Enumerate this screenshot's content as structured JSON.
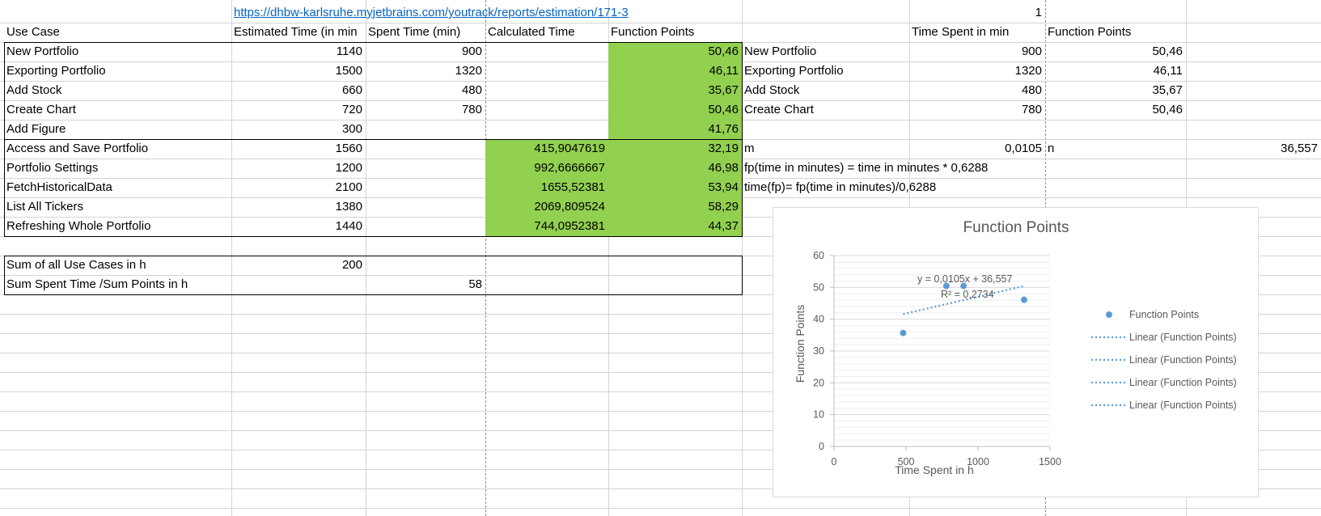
{
  "sheet": {
    "link": "https://dhbw-karlsruhe.myjetbrains.com/youtrack/reports/estimation/171-3",
    "top_value": "1",
    "headers": {
      "use_case": "Use Case",
      "estimated_time": "Estimated Time (in min",
      "spent_time": "Spent Time (min)",
      "calculated_time": "Calculated Time",
      "function_points": "Function Points",
      "right_time": "Time Spent in min",
      "right_fp": "Function Points"
    },
    "rows": [
      {
        "use_case": "New Portfolio",
        "estimated": "1140",
        "spent": "900",
        "calculated": "",
        "fp": "50,46"
      },
      {
        "use_case": "Exporting Portfolio",
        "estimated": "1500",
        "spent": "1320",
        "calculated": "",
        "fp": "46,11"
      },
      {
        "use_case": "Add Stock",
        "estimated": "660",
        "spent": "480",
        "calculated": "",
        "fp": "35,67"
      },
      {
        "use_case": "Create Chart",
        "estimated": "720",
        "spent": "780",
        "calculated": "",
        "fp": "50,46"
      },
      {
        "use_case": "Add Figure",
        "estimated": "300",
        "spent": "",
        "calculated": "",
        "fp": "41,76"
      },
      {
        "use_case": "Access and Save Portfolio",
        "estimated": "1560",
        "spent": "",
        "calculated": "415,9047619",
        "fp": "32,19"
      },
      {
        "use_case": "Portfolio Settings",
        "estimated": "1200",
        "spent": "",
        "calculated": "992,6666667",
        "fp": "46,98"
      },
      {
        "use_case": "FetchHistoricalData",
        "estimated": "2100",
        "spent": "",
        "calculated": "1655,52381",
        "fp": "53,94"
      },
      {
        "use_case": "List All Tickers",
        "estimated": "1380",
        "spent": "",
        "calculated": "2069,809524",
        "fp": "58,29"
      },
      {
        "use_case": "Refreshing Whole Portfolio",
        "estimated": "1440",
        "spent": "",
        "calculated": "744,0952381",
        "fp": "44,37"
      }
    ],
    "right_rows": [
      {
        "label": "New Portfolio",
        "time": "900",
        "fp": "50,46"
      },
      {
        "label": "Exporting Portfolio",
        "time": "1320",
        "fp": "46,11"
      },
      {
        "label": "Add Stock",
        "time": "480",
        "fp": "35,67"
      },
      {
        "label": "Create Chart",
        "time": "780",
        "fp": "50,46"
      }
    ],
    "regression": {
      "m_label": "m",
      "m_value": "0,0105",
      "n_label": "n",
      "n_value": "36,557",
      "formula1": "fp(time in minutes) = time in minutes * 0,6288",
      "formula2": "time(fp)= fp(time in minutes)/0,6288"
    },
    "summary": {
      "sum_label": "Sum of all Use Cases in h",
      "sum_value": "200",
      "ratio_label": "Sum Spent Time /Sum Points in h",
      "ratio_value": "58"
    },
    "colors": {
      "highlight": "#92d050",
      "link": "#0563c1",
      "series": "#5b9bd5"
    }
  },
  "chart_data": {
    "type": "scatter",
    "title": "Function Points",
    "xlabel": "Time Spent in h",
    "ylabel": "Function Points",
    "xlim": [
      0,
      1500
    ],
    "ylim": [
      0,
      60
    ],
    "x_ticks": [
      "0",
      "500",
      "1000",
      "1500"
    ],
    "y_ticks": [
      "0",
      "10",
      "20",
      "30",
      "40",
      "50",
      "60"
    ],
    "series": [
      {
        "name": "Function Points",
        "x": [
          900,
          1320,
          480,
          780
        ],
        "y": [
          50.46,
          46.11,
          35.67,
          50.46
        ]
      }
    ],
    "trendline": {
      "slope": 0.0105,
      "intercept": 36.557,
      "x_range": [
        480,
        1320
      ],
      "equation": "y = 0,0105x + 36,557",
      "r2": "R² = 0,2734"
    },
    "legend": [
      "Function Points",
      "Linear (Function Points)",
      "Linear (Function Points)",
      "Linear (Function Points)",
      "Linear (Function Points)"
    ],
    "legend_position": "right",
    "grid": true
  }
}
